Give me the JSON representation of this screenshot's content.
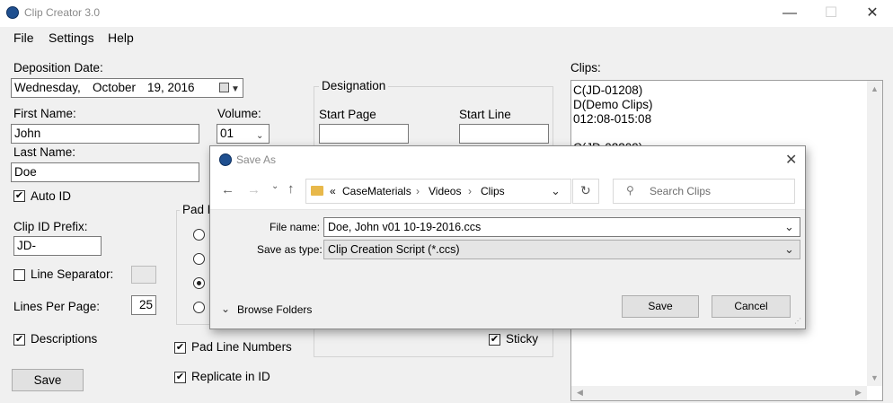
{
  "window": {
    "title": "Clip Creator 3.0",
    "min": "—",
    "max": "☐",
    "close": "✕"
  },
  "menu": [
    "File",
    "Settings",
    "Help"
  ],
  "form": {
    "deposition_date_label": "Deposition Date:",
    "date_weekday": "Wednesday,",
    "date_month": "October",
    "date_day_year": "19, 2016",
    "first_name_label": "First Name:",
    "first_name": "John",
    "last_name_label": "Last Name:",
    "last_name": "Doe",
    "volume_label": "Volume:",
    "volume": "01",
    "auto_id_label": "Auto ID",
    "auto_id_checked": true,
    "clip_id_prefix_label": "Clip ID Prefix:",
    "clip_id_prefix": "JD-",
    "line_separator_label": "Line Separator:",
    "line_separator_checked": false,
    "lines_per_page_label": "Lines Per Page:",
    "lines_per_page": "25",
    "descriptions_label": "Descriptions",
    "descriptions_checked": true,
    "pad_group_title": "Pad P",
    "pad_line_numbers_label": "Pad Line Numbers",
    "pad_line_numbers_checked": true,
    "replicate_in_id_label": "Replicate in ID",
    "replicate_in_id_checked": true,
    "save_label": "Save"
  },
  "designation": {
    "title": "Designation",
    "start_page_label": "Start Page",
    "start_line_label": "Start Line",
    "start_page": "",
    "start_line": "",
    "sticky_label": "Sticky",
    "sticky_checked": true
  },
  "clips": {
    "label": "Clips:",
    "lines": [
      "C(JD-01208)",
      "D(Demo Clips)",
      "012:08-015:08",
      "",
      "C(JD-02209)"
    ]
  },
  "save_dialog": {
    "title": "Save As",
    "breadcrumb_prefix": "«",
    "path": [
      "CaseMaterials",
      "Videos",
      "Clips"
    ],
    "search_placeholder": "Search Clips",
    "file_name_label": "File name:",
    "file_name": "Doe, John v01 10-19-2016.ccs",
    "save_type_label": "Save as type:",
    "save_type": "Clip Creation Script (*.ccs)",
    "browse_folders_label": "Browse Folders",
    "save_label": "Save",
    "cancel_label": "Cancel"
  },
  "colors": {
    "accent": "#1f4f8f",
    "window_bg": "#f0f0f0",
    "folder": "#e8b84a"
  }
}
